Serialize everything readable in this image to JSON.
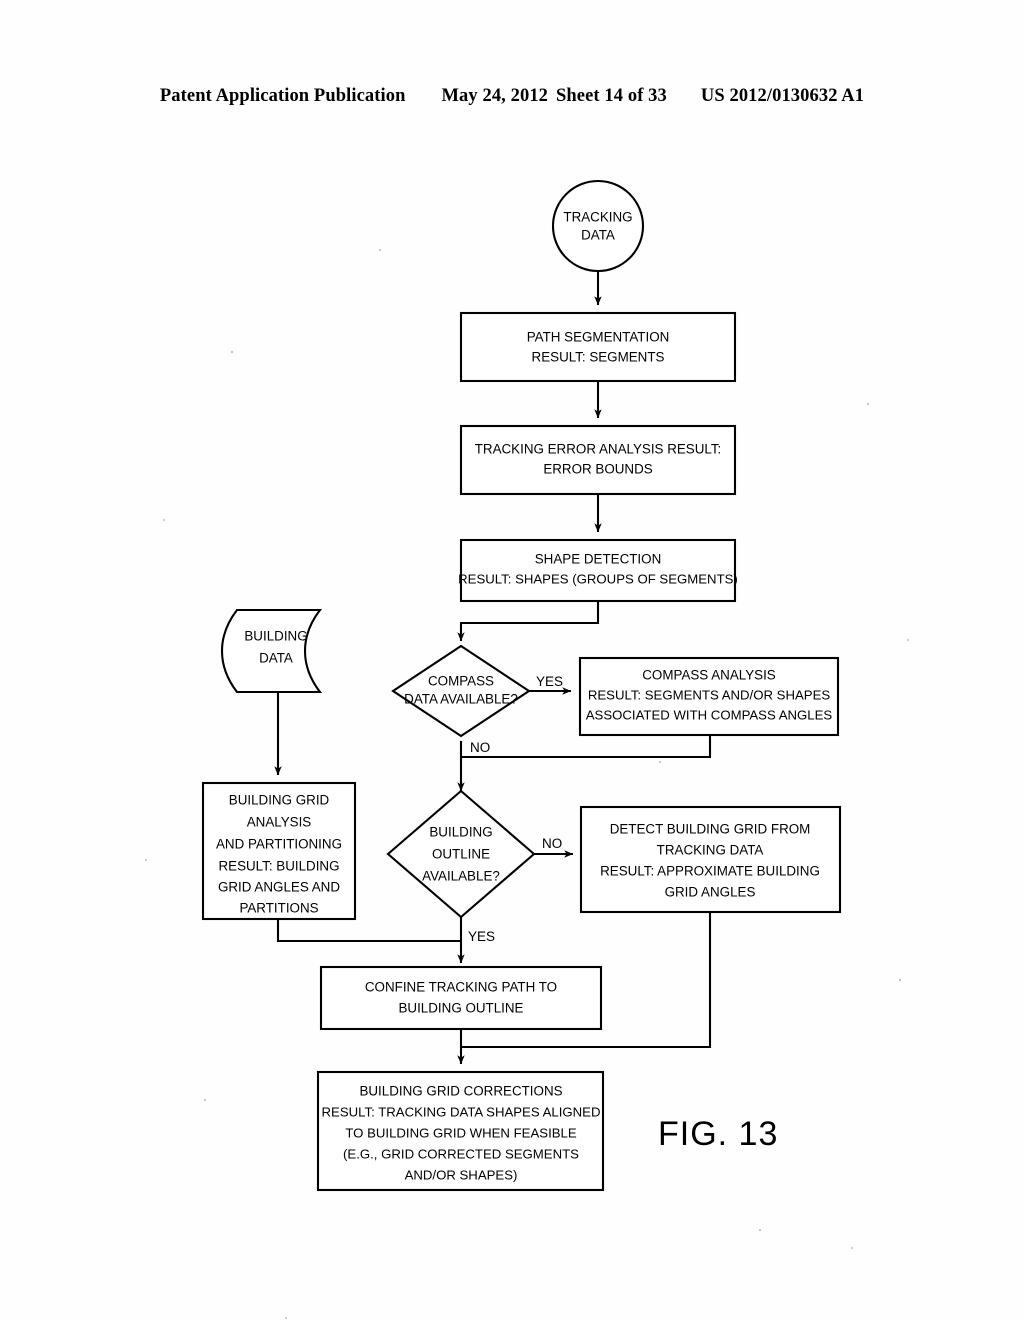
{
  "header": {
    "publication": "Patent Application Publication",
    "date": "May 24, 2012",
    "sheet": "Sheet 14 of 33",
    "number": "US 2012/0130632 A1"
  },
  "figure": {
    "label": "FIG. 13"
  },
  "nodes": {
    "tracking_data": {
      "shape": "circle",
      "lines": [
        "TRACKING",
        "DATA"
      ]
    },
    "path_segmentation": {
      "shape": "process",
      "lines": [
        "PATH SEGMENTATION",
        "RESULT: SEGMENTS"
      ]
    },
    "tracking_error": {
      "shape": "process",
      "lines": [
        "TRACKING ERROR ANALYSIS RESULT:",
        "ERROR BOUNDS"
      ]
    },
    "shape_detection": {
      "shape": "process",
      "lines": [
        "SHAPE DETECTION",
        "RESULT: SHAPES (GROUPS OF SEGMENTS)"
      ]
    },
    "building_data": {
      "shape": "stored-data",
      "lines": [
        "BUILDING",
        "DATA"
      ]
    },
    "compass_decision": {
      "shape": "decision",
      "lines": [
        "COMPASS",
        "DATA AVAILABLE?"
      ]
    },
    "compass_analysis": {
      "shape": "process",
      "lines": [
        "COMPASS ANALYSIS",
        "RESULT: SEGMENTS AND/OR SHAPES",
        "ASSOCIATED WITH COMPASS ANGLES"
      ]
    },
    "building_grid_analysis": {
      "shape": "process",
      "lines": [
        "BUILDING GRID",
        "ANALYSIS",
        "AND PARTITIONING",
        "RESULT: BUILDING",
        "GRID ANGLES AND",
        "PARTITIONS"
      ]
    },
    "outline_decision": {
      "shape": "decision",
      "lines": [
        "BUILDING",
        "OUTLINE",
        "AVAILABLE?"
      ]
    },
    "detect_grid": {
      "shape": "process",
      "lines": [
        "DETECT BUILDING GRID FROM",
        "TRACKING DATA",
        "RESULT: APPROXIMATE BUILDING",
        "GRID ANGLES"
      ]
    },
    "confine_path": {
      "shape": "process",
      "lines": [
        "CONFINE TRACKING PATH TO",
        "BUILDING OUTLINE"
      ]
    },
    "grid_corrections": {
      "shape": "process",
      "lines": [
        "BUILDING GRID CORRECTIONS",
        "RESULT: TRACKING DATA SHAPES ALIGNED",
        "TO BUILDING GRID WHEN FEASIBLE",
        "(E.G., GRID CORRECTED SEGMENTS",
        "AND/OR SHAPES)"
      ]
    }
  },
  "edge_labels": {
    "compass_yes": "YES",
    "compass_no": "NO",
    "outline_no": "NO",
    "outline_yes": "YES"
  },
  "colors": {
    "ink": "#000000",
    "paper": "#ffffff"
  }
}
